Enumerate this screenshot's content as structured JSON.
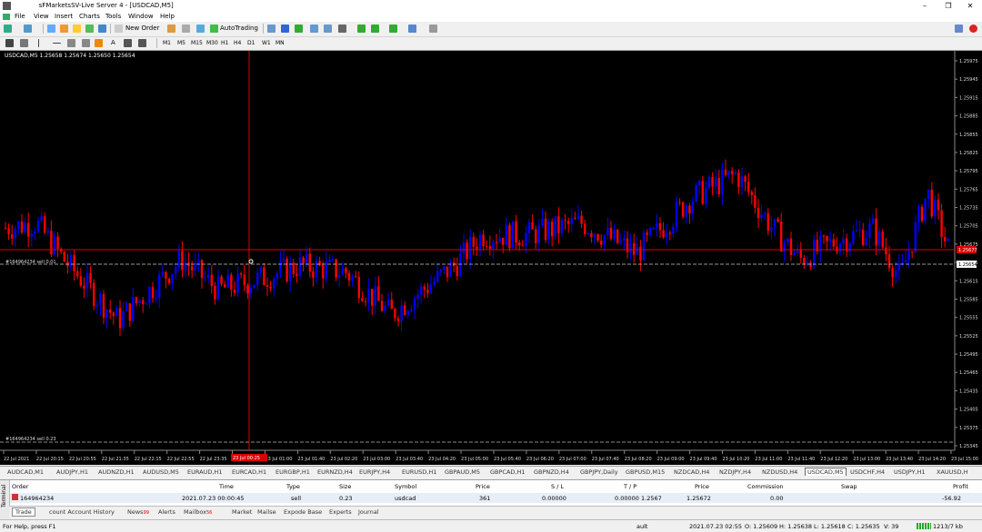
{
  "window": {
    "title": "            sFMarketsSV-Live Server 4 - [USDCAD,M5]",
    "minimize": "–",
    "maximize": "❐",
    "close": "✕"
  },
  "menu": [
    "File",
    "View",
    "Insert",
    "Charts",
    "Tools",
    "Window",
    "Help"
  ],
  "toolbar": {
    "new_order": "New Order",
    "autotrading": "AutoTrading"
  },
  "timeframes": [
    "M1",
    "M5",
    "M15",
    "M30",
    "H1",
    "H4",
    "D1",
    "W1",
    "MN"
  ],
  "chart": {
    "header": "USDCAD,M5  1.25658 1.25674 1.25650 1.25654",
    "price_ticks": [
      "1.25975",
      "1.25945",
      "1.25915",
      "1.25885",
      "1.25855",
      "1.25825",
      "1.25795",
      "1.25765",
      "1.25735",
      "1.25705",
      "1.25675",
      "1.25645",
      "1.25615",
      "1.25585",
      "1.25555",
      "1.25525",
      "1.25495",
      "1.25465",
      "1.25435",
      "1.25405",
      "1.25375",
      "1.25345"
    ],
    "current_price": "1.25654",
    "order_label": "1.25677",
    "order_line_label": "#164964234  sell 0.01",
    "sl_line_label": "#164964234  sell 0.23",
    "time_ticks": [
      "22 Jul 2021",
      "22 Jul 20:15",
      "22 Jul 20:55",
      "22 Jul 21:35",
      "22 Jul 22:15",
      "22 Jul 22:55",
      "22 Jul 23:35",
      "23 Jul 00:15",
      "23 Jul 01:00",
      "23 Jul 01:40",
      "23 Jul 02:20",
      "23 Jul 03:00",
      "23 Jul 03:40",
      "23 Jul 04:20",
      "23 Jul 05:00",
      "23 Jul 05:40",
      "23 Jul 06:20",
      "23 Jul 07:00",
      "23 Jul 07:40",
      "23 Jul 08:20",
      "23 Jul 09:00",
      "23 Jul 09:40",
      "23 Jul 10:20",
      "23 Jul 11:00",
      "23 Jul 11:40",
      "23 Jul 12:20",
      "23 Jul 13:00",
      "23 Jul 13:40",
      "23 Jul 14:20",
      "23 Jul 15:00"
    ],
    "crosshair_time": "23 Jul 00:25",
    "up_color": "#0000ff",
    "down_color": "#ff0000"
  },
  "symbol_tabs": [
    "AUDCAD,M1",
    "AUDJPY,H1",
    "AUDNZD,H1",
    "AUDUSD,M5",
    "EURAUD,H1",
    "EURCAD,H1",
    "EURGBP,H1",
    "EURNZD,H4",
    "EURJPY,H4",
    "EURUSD,H1",
    "GBPAUD,M5",
    "GBPCAD,H1",
    "GBPNZD,H4",
    "GBPJPY,Daily",
    "GBPUSD,M15",
    "NZDCAD,H4",
    "NZDJPY,H4",
    "NZDUSD,H4",
    "USDCAD,M5",
    "USDCHF,H4",
    "USDJPY,H1",
    "XAUUSD,H"
  ],
  "active_symbol_tab": "USDCAD,M5",
  "terminal": {
    "side_label": "Terminal",
    "headers": [
      "Order",
      "Time",
      "Type",
      "Size",
      "Symbol",
      "Price",
      "S / L",
      "T / P",
      "Price",
      "Commission",
      "Swap",
      "Profit"
    ],
    "row": {
      "order": "164964234",
      "time": "2021.07.23 00:00:45",
      "type": "sell",
      "size": "0.23",
      "symbol": "usdcad",
      "price": "361",
      "sl": "0.00000",
      "tp": "0.00000",
      "price2": "1.25672",
      "commission": "0.00",
      "profit": "-56.92",
      "ticket_short": "1.2567"
    },
    "tabs": [
      {
        "label": "Trade",
        "badge": ""
      },
      {
        "label": "count Account History",
        "badge": ""
      },
      {
        "label": "News",
        "badge": "99"
      },
      {
        "label": "Alerts",
        "badge": ""
      },
      {
        "label": "Mailbox",
        "badge": "56"
      },
      {
        "label": "Market",
        "badge": ""
      },
      {
        "label": "Mailse",
        "badge": ""
      },
      {
        "label": "Expode Base",
        "badge": ""
      },
      {
        "label": "Experts",
        "badge": ""
      },
      {
        "label": "Journal",
        "badge": ""
      }
    ]
  },
  "status": {
    "help": "For Help, press F1",
    "profile": "ault",
    "time": "2021.07.23 02:55",
    "open": "O: 1.25609",
    "high": "H: 1.25638",
    "low": "L: 1.25618",
    "close": "C: 1.25635",
    "volume": "V: 39",
    "traffic": "1213/7 kb"
  }
}
